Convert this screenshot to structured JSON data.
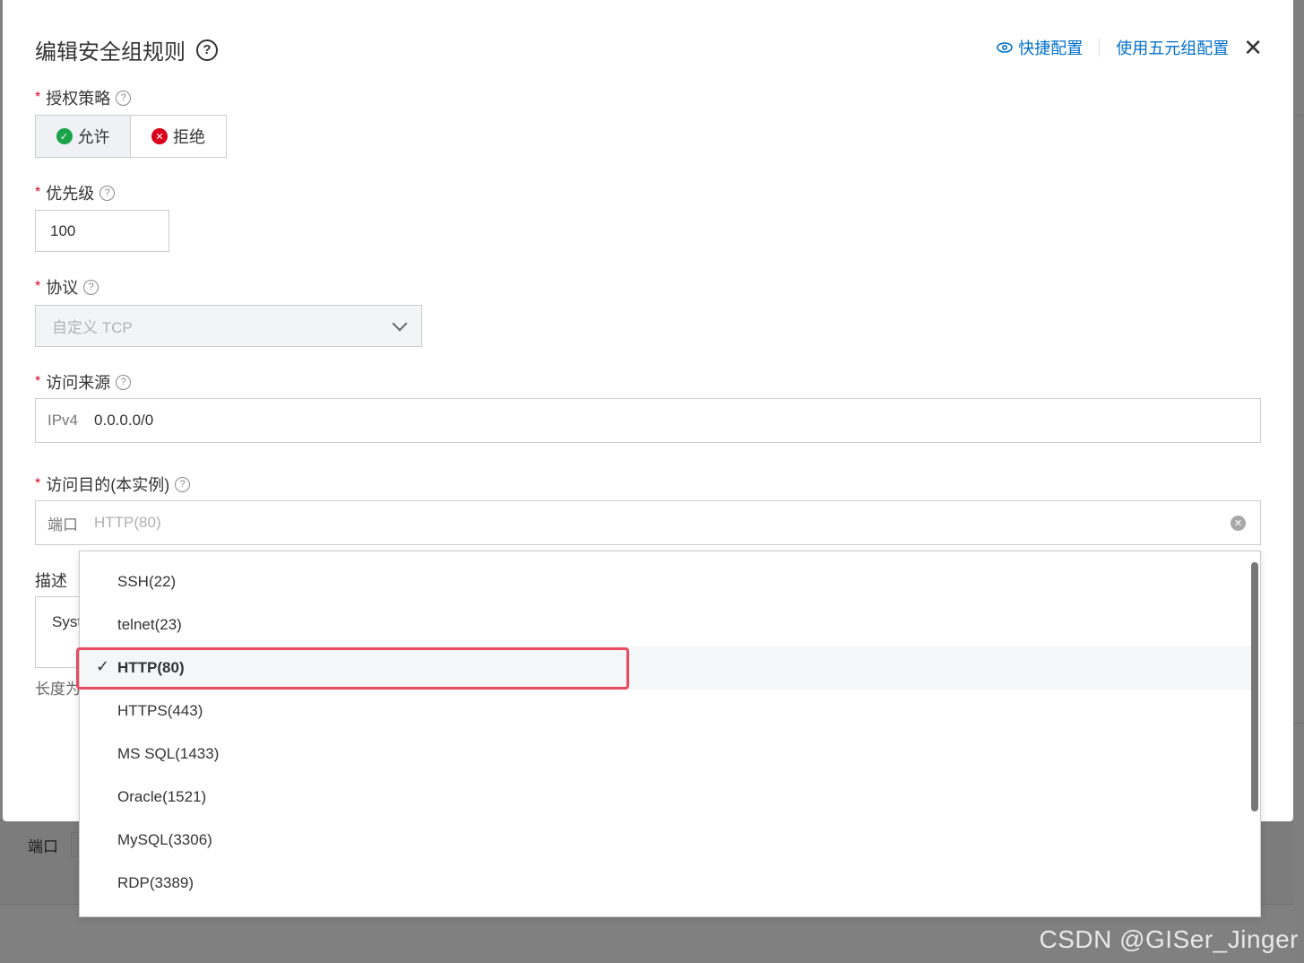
{
  "modal": {
    "title": "编辑安全组规则",
    "quick_config": "快捷配置",
    "five_tuple": "使用五元组配置"
  },
  "policy": {
    "label": "授权策略",
    "allow": "允许",
    "deny": "拒绝"
  },
  "priority": {
    "label": "优先级",
    "value": "100"
  },
  "protocol": {
    "label": "协议",
    "value": "自定义 TCP"
  },
  "source": {
    "label": "访问来源",
    "prefix": "IPv4",
    "value": "0.0.0.0/0"
  },
  "destination": {
    "label": "访问目的(本实例)",
    "prefix": "端口",
    "placeholder": "HTTP(80)"
  },
  "description": {
    "label": "描述",
    "value": "Syst",
    "hint": "长度为"
  },
  "dropdown": {
    "items": [
      "SSH(22)",
      "telnet(23)",
      "HTTP(80)",
      "HTTPS(443)",
      "MS SQL(1433)",
      "Oracle(1521)",
      "MySQL(3306)",
      "RDP(3389)"
    ],
    "selected": "HTTP(80)"
  },
  "background": {
    "port_label": "端口"
  },
  "watermark": "CSDN @GISer_Jinger"
}
